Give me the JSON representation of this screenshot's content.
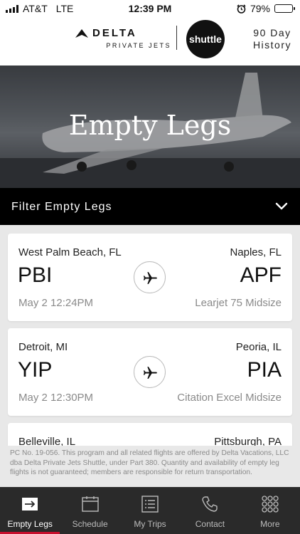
{
  "status_bar": {
    "carrier": "AT&T",
    "network": "LTE",
    "time": "12:39 PM",
    "battery": "79%",
    "battery_level": 0.79
  },
  "header": {
    "brand": "DELTA",
    "brand_sub": "PRIVATE JETS",
    "shuttle_logo": "shuttle",
    "history_line1": "90 Day",
    "history_line2": "History"
  },
  "hero": {
    "title": "Empty Legs"
  },
  "filter": {
    "label": "Filter Empty Legs",
    "icon": "chevron-down-icon"
  },
  "legs": [
    {
      "from_city": "West Palm Beach, FL",
      "to_city": "Naples, FL",
      "from_code": "PBI",
      "to_code": "APF",
      "datetime": "May 2 12:24PM",
      "aircraft": "Learjet 75 Midsize"
    },
    {
      "from_city": "Detroit, MI",
      "to_city": "Peoria, IL",
      "from_code": "YIP",
      "to_code": "PIA",
      "datetime": "May 2 12:30PM",
      "aircraft": "Citation Excel Midsize"
    },
    {
      "from_city": "Belleville, IL",
      "to_city": "Pittsburgh, PA"
    }
  ],
  "disclaimer": "PC No. 19-056. This program and all related flights are offered by Delta Vacations, LLC dba Delta Private Jets Shuttle, under Part 380. Quantity and availability of empty leg flights is not guaranteed; members are responsible for return transportation.",
  "tabs": [
    {
      "label": "Empty Legs",
      "icon": "arrow-right-icon",
      "active": true
    },
    {
      "label": "Schedule",
      "icon": "calendar-icon",
      "active": false
    },
    {
      "label": "My Trips",
      "icon": "list-icon",
      "active": false
    },
    {
      "label": "Contact",
      "icon": "phone-icon",
      "active": false
    },
    {
      "label": "More",
      "icon": "grid-icon",
      "active": false
    }
  ],
  "colors": {
    "accent": "#c8102e",
    "tabbar": "#2a2a2a",
    "filter_bar": "#000000"
  }
}
